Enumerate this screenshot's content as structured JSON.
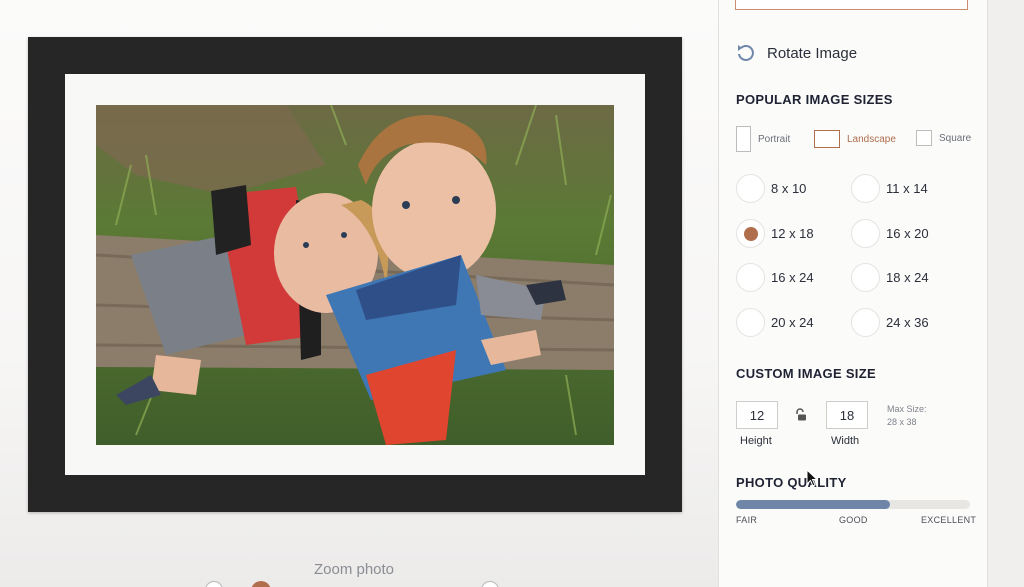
{
  "preview": {
    "zoom_label": "Zoom photo"
  },
  "panel": {
    "rotate_label": "Rotate Image",
    "popular_title": "POPULAR IMAGE SIZES",
    "orientations": [
      {
        "label": "Portrait",
        "active": false
      },
      {
        "label": "Landscape",
        "active": true
      },
      {
        "label": "Square",
        "active": false
      }
    ],
    "sizes": [
      {
        "label": "8 x 10",
        "checked": false
      },
      {
        "label": "11 x 14",
        "checked": false
      },
      {
        "label": "12 x 18",
        "checked": true
      },
      {
        "label": "16 x 20",
        "checked": false
      },
      {
        "label": "16 x 24",
        "checked": false
      },
      {
        "label": "18 x 24",
        "checked": false
      },
      {
        "label": "20 x 24",
        "checked": false
      },
      {
        "label": "24 x 36",
        "checked": false
      }
    ],
    "custom_title": "CUSTOM IMAGE SIZE",
    "custom": {
      "height_value": "12",
      "width_value": "18",
      "height_label": "Height",
      "width_label": "Width",
      "max_size_label": "Max Size:",
      "max_size_value": "28 x 38"
    },
    "quality_title": "PHOTO QUALITY",
    "quality": {
      "level": 0.66,
      "labels": [
        "FAIR",
        "GOOD",
        "EXCELLENT"
      ]
    }
  },
  "colors": {
    "accent": "#b06e4c",
    "quality_fill": "#6f86a8",
    "frame": "#262626"
  }
}
